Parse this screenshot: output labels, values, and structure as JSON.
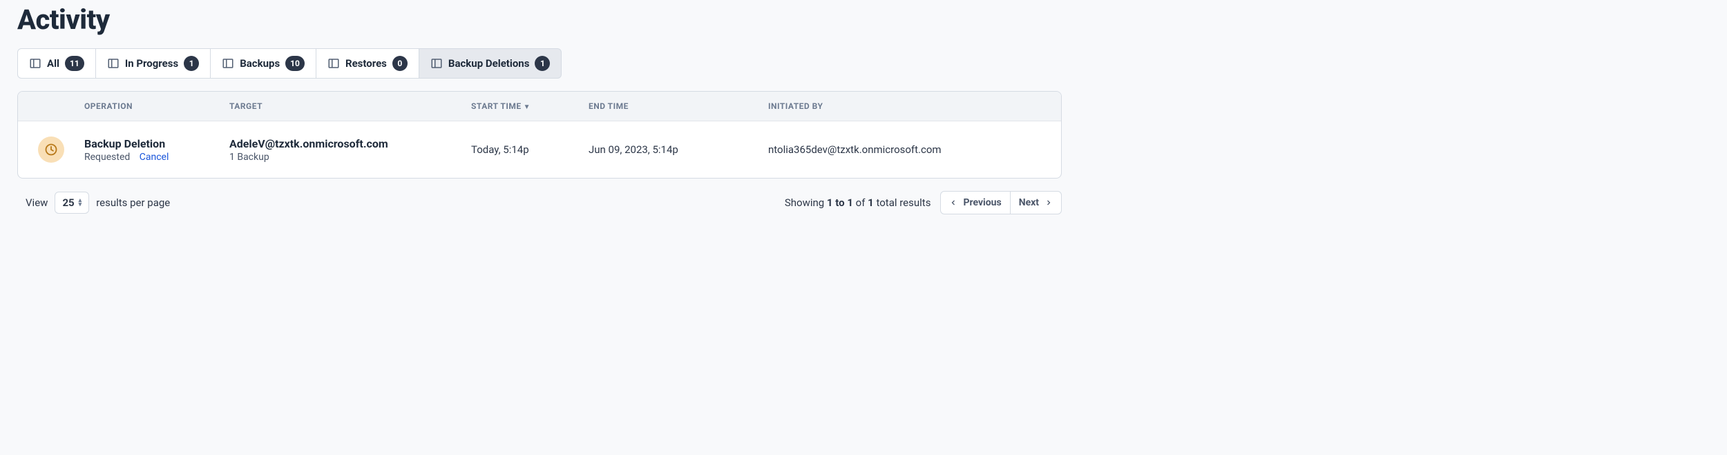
{
  "title": "Activity",
  "tabs": [
    {
      "label": "All",
      "count": "11"
    },
    {
      "label": "In Progress",
      "count": "1"
    },
    {
      "label": "Backups",
      "count": "10"
    },
    {
      "label": "Restores",
      "count": "0"
    },
    {
      "label": "Backup Deletions",
      "count": "1"
    }
  ],
  "columns": {
    "operation": "Operation",
    "target": "Target",
    "start": "Start Time",
    "end": "End Time",
    "initiated": "Initiated By"
  },
  "rows": [
    {
      "op_title": "Backup Deletion",
      "op_status": "Requested",
      "op_cancel": "Cancel",
      "target_title": "AdeleV@tzxtk.onmicrosoft.com",
      "target_sub": "1 Backup",
      "start": "Today, 5:14p",
      "end": "Jun 09, 2023, 5:14p",
      "initiated": "ntolia365dev@tzxtk.onmicrosoft.com"
    }
  ],
  "pagination": {
    "view_label": "View",
    "per_page": "25",
    "results_label": "results per page",
    "showing_prefix": "Showing ",
    "range": "1 to 1",
    "of_label": " of ",
    "total": "1",
    "total_suffix": " total results",
    "prev": "Previous",
    "next": "Next"
  }
}
